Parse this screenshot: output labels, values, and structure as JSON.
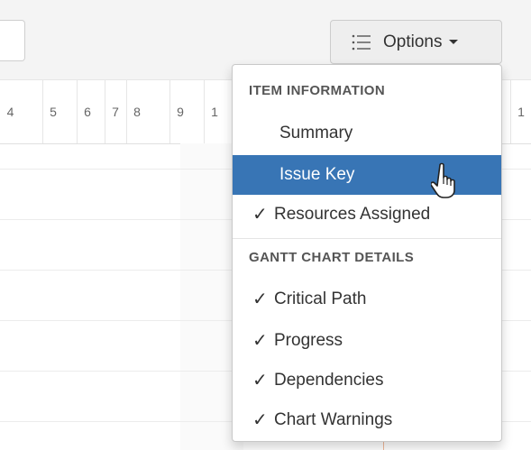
{
  "toolbar": {
    "options_label": "Options",
    "options_icon": "list-icon"
  },
  "timeline": {
    "days": [
      "4",
      "5",
      "6",
      "7",
      "8",
      "9",
      "1",
      "1"
    ]
  },
  "dropdown": {
    "item_information_header": "ITEM INFORMATION",
    "gantt_chart_details_header": "GANTT CHART DETAILS",
    "item_information": [
      {
        "label": "Summary",
        "checked": false,
        "highlighted": false
      },
      {
        "label": "Issue Key",
        "checked": false,
        "highlighted": true
      },
      {
        "label": "Resources Assigned",
        "checked": true,
        "highlighted": false
      }
    ],
    "gantt_chart_details": [
      {
        "label": "Critical Path",
        "checked": true
      },
      {
        "label": "Progress",
        "checked": true
      },
      {
        "label": "Dependencies",
        "checked": true
      },
      {
        "label": "Chart Warnings",
        "checked": true
      }
    ],
    "check_glyph": "✓"
  },
  "colors": {
    "highlight": "#3875b5",
    "toolbar_bg": "#f4f4f4",
    "button_bg": "#eeeeee"
  }
}
